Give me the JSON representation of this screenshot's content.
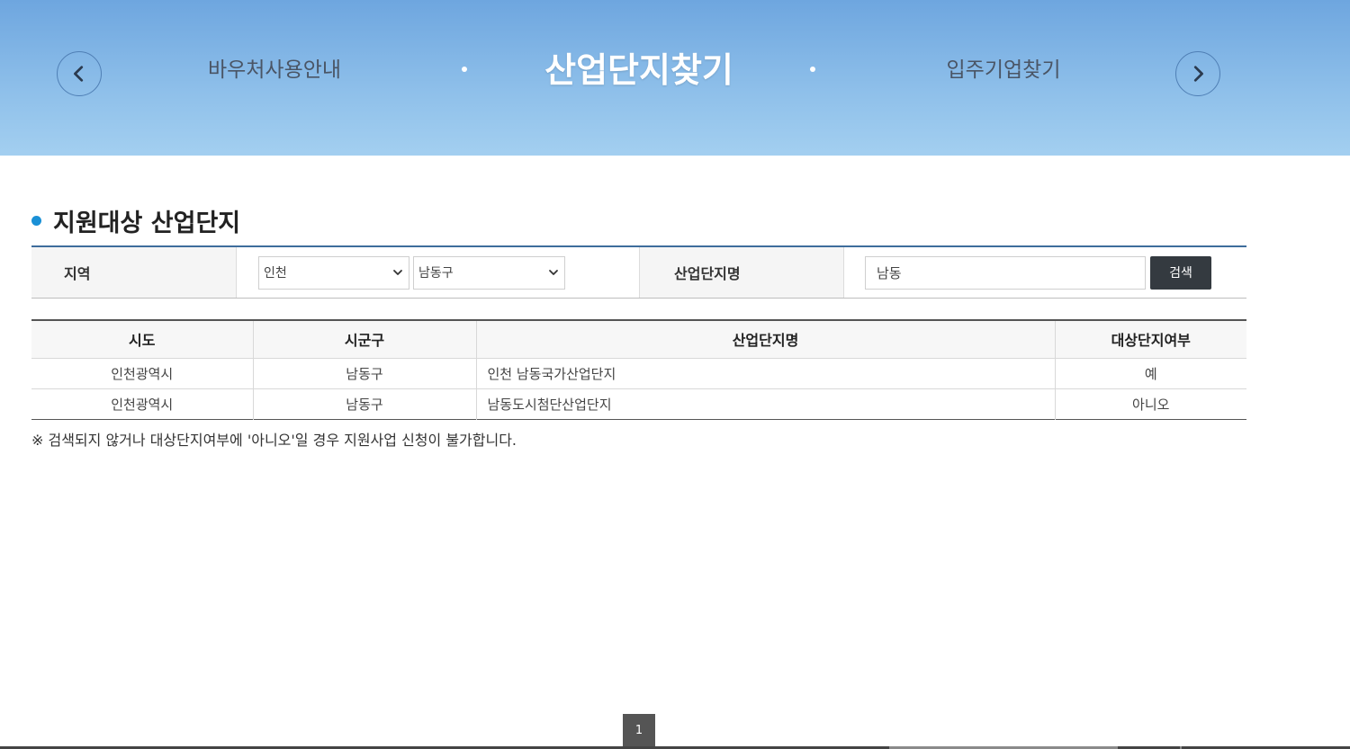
{
  "banner": {
    "prev_label": "이전",
    "next_label": "다음",
    "left_item": "바우처사용안내",
    "center_item": "산업단지찾기",
    "right_item": "입주기업찾기"
  },
  "section": {
    "title": "지원대상 산업단지"
  },
  "search": {
    "region_label": "지역",
    "sido_selected": "인천",
    "sigungu_selected": "남동구",
    "name_label": "산업단지명",
    "name_value": "남동",
    "search_button": "검색"
  },
  "table": {
    "headers": [
      "시도",
      "시군구",
      "산업단지명",
      "대상단지여부"
    ],
    "rows": [
      {
        "sido": "인천광역시",
        "sigungu": "남동구",
        "name": "인천 남동국가산업단지",
        "eligible": "예"
      },
      {
        "sido": "인천광역시",
        "sigungu": "남동구",
        "name": "남동도시첨단산업단지",
        "eligible": "아니오"
      }
    ]
  },
  "notice": "※ 검색되지 않거나 대상단지여부에 '아니오'일 경우 지원사업 신청이 불가합니다.",
  "pagination": {
    "current_page": "1"
  },
  "colors": {
    "accent": "#1a90d6",
    "button": "#343a40"
  }
}
